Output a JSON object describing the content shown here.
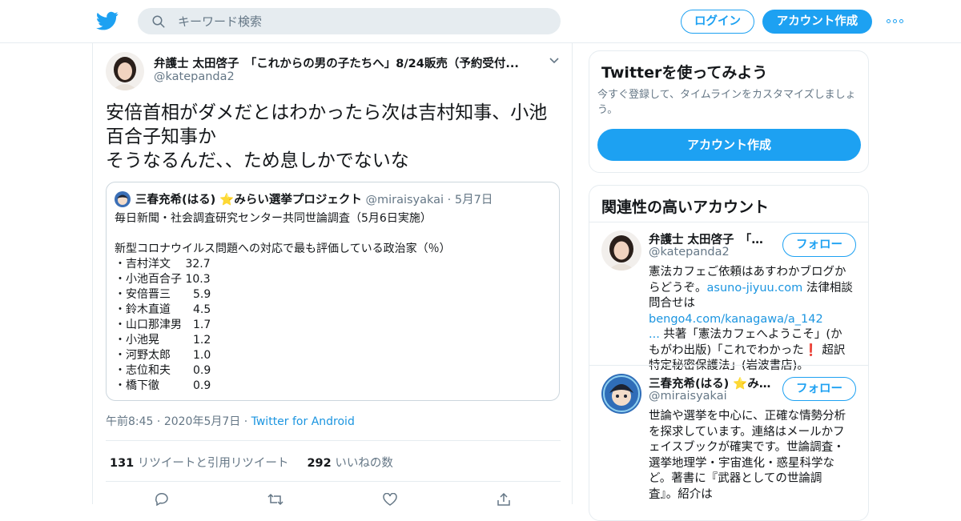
{
  "colors": {
    "brand": "#1da1f2",
    "link": "#1b95e0",
    "muted": "#657786",
    "border": "#e6ecf0"
  },
  "header": {
    "logo_icon": "twitter-bird-icon",
    "search_placeholder": "キーワード検索",
    "login_label": "ログイン",
    "signup_label": "アカウント作成",
    "more_icon": "more-dots-icon"
  },
  "tweet": {
    "author_name": "弁護士 太田啓子　「これからの男の子たちへ」8/24販売（予約受付...",
    "author_handle": "@katepanda2",
    "text_lines": [
      "安倍首相がダメだとはわかったら次は吉村知事、小池",
      "百合子知事か",
      "そうなるんだ、、ため息しかでないな"
    ],
    "quote": {
      "name": "三春充希(はる) ⭐みらい選挙プロジェクト",
      "handle": "@miraisyakai",
      "date": "5月7日",
      "title": "毎日新聞・社会調査研究センター共同世論調査（5月6日実施）",
      "subtitle": "新型コロナウイルス問題への対応で最も評価している政治家（％）",
      "rows": [
        "・吉村洋文　 32.7",
        "・小池百合子 10.3",
        "・安倍晋三　　5.9",
        "・鈴木直道　　4.5",
        "・山口那津男　1.7",
        "・小池晃　　　1.2",
        "・河野太郎　　1.0",
        "・志位和夫　　0.9",
        "・橋下徹　　　0.9"
      ]
    },
    "time": "午前8:45",
    "date": "2020年5月7日",
    "source": "Twitter for Android",
    "retweets": "131",
    "retweets_label": "リツイートと引用リツイート",
    "likes": "292",
    "likes_label": "いいねの数"
  },
  "sidebar": {
    "signup_card": {
      "title": "Twitterを使ってみよう",
      "text": "今すぐ登録して、タイムラインをカスタマイズしましょう。",
      "button": "アカウント作成"
    },
    "related": {
      "title": "関連性の高いアカウント",
      "follow_label": "フォロー",
      "accounts": [
        {
          "name": "弁護士 太田啓子　「これからの男の子たちへ」",
          "handle": "@katepanda2",
          "bio": [
            "憲法カフェご依頼はあすわかブログか",
            "らどうぞ。",
            "asuno-jiyuu.com",
            " 法律相談",
            "問合せは",
            "bengo4.com/kanagawa/a_142",
            "...",
            " 共著「憲法カフェへようこそ」(か",
            "もがわ出版)「これでわかった",
            "❗",
            " 超訳",
            "特定秘密保護法」(岩波書店)。"
          ]
        },
        {
          "name": "三春充希(はる) ⭐みらい選挙プロジェクト",
          "handle": "@miraisyakai",
          "bio": [
            "世論や選挙を中心に、正確な情勢分析",
            "を探求しています。連絡はメールかフ",
            "ェイスブックが確実です。世論調査・",
            "選挙地理学・宇宙進化・惑星科学な",
            "ど。著書に『武器としての世論調",
            "査』。紹介は"
          ]
        }
      ]
    }
  }
}
